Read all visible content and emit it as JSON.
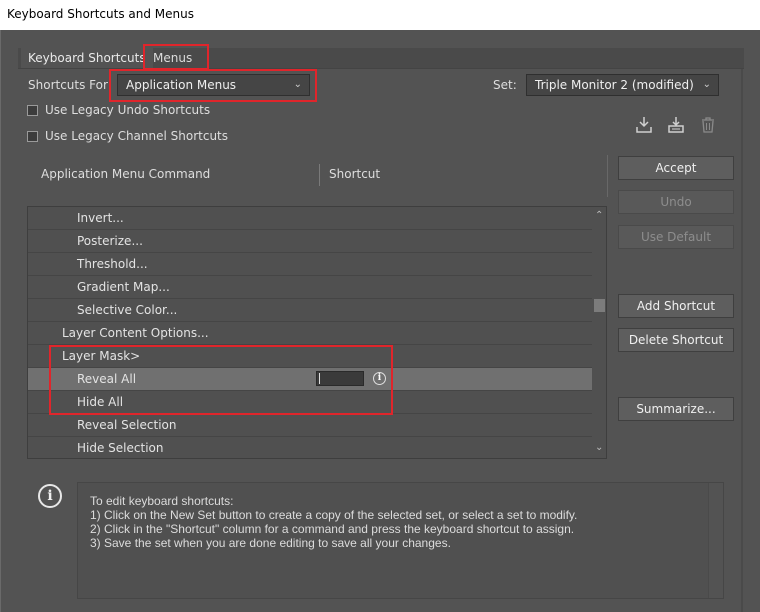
{
  "window": {
    "title": "Keyboard Shortcuts and Menus"
  },
  "tabs": [
    {
      "label": "Keyboard Shortcuts"
    },
    {
      "label": "Menus"
    }
  ],
  "shortcuts_for": {
    "label": "Shortcuts For:",
    "value": "Application Menus"
  },
  "set": {
    "label": "Set:",
    "value": "Triple Monitor 2 (modified)"
  },
  "options": {
    "legacy_undo": {
      "label": "Use Legacy Undo Shortcuts",
      "checked": false
    },
    "legacy_channel": {
      "label": "Use Legacy Channel Shortcuts",
      "checked": false
    }
  },
  "icons": {
    "save_set": "save-set-icon",
    "new_set": "new-set-icon",
    "delete_set": "trash-icon"
  },
  "table": {
    "headers": [
      "Application Menu Command",
      "Shortcut"
    ],
    "rows": [
      {
        "label": "Invert...",
        "level": 2
      },
      {
        "label": "Posterize...",
        "level": 2
      },
      {
        "label": "Threshold...",
        "level": 2
      },
      {
        "label": "Gradient Map...",
        "level": 2
      },
      {
        "label": "Selective Color...",
        "level": 2
      },
      {
        "label": "Layer Content Options...",
        "level": 1
      },
      {
        "label": "Layer Mask>",
        "level": 1
      },
      {
        "label": "Reveal All",
        "level": 2,
        "selected": true
      },
      {
        "label": "Hide All",
        "level": 2
      },
      {
        "label": "Reveal Selection",
        "level": 2
      },
      {
        "label": "Hide Selection",
        "level": 2
      }
    ]
  },
  "buttons": {
    "accept": "Accept",
    "undo": "Undo",
    "use_default": "Use Default",
    "add_shortcut": "Add Shortcut",
    "delete_shortcut": "Delete Shortcut",
    "summarize": "Summarize..."
  },
  "info": {
    "lines": [
      "To edit keyboard shortcuts:",
      "1) Click on the New Set button to create a copy of the selected set, or select a set to modify.",
      "2) Click in the \"Shortcut\" column for a command and press the keyboard shortcut to assign.",
      "3) Save the set when you are done editing to save all your changes."
    ]
  }
}
